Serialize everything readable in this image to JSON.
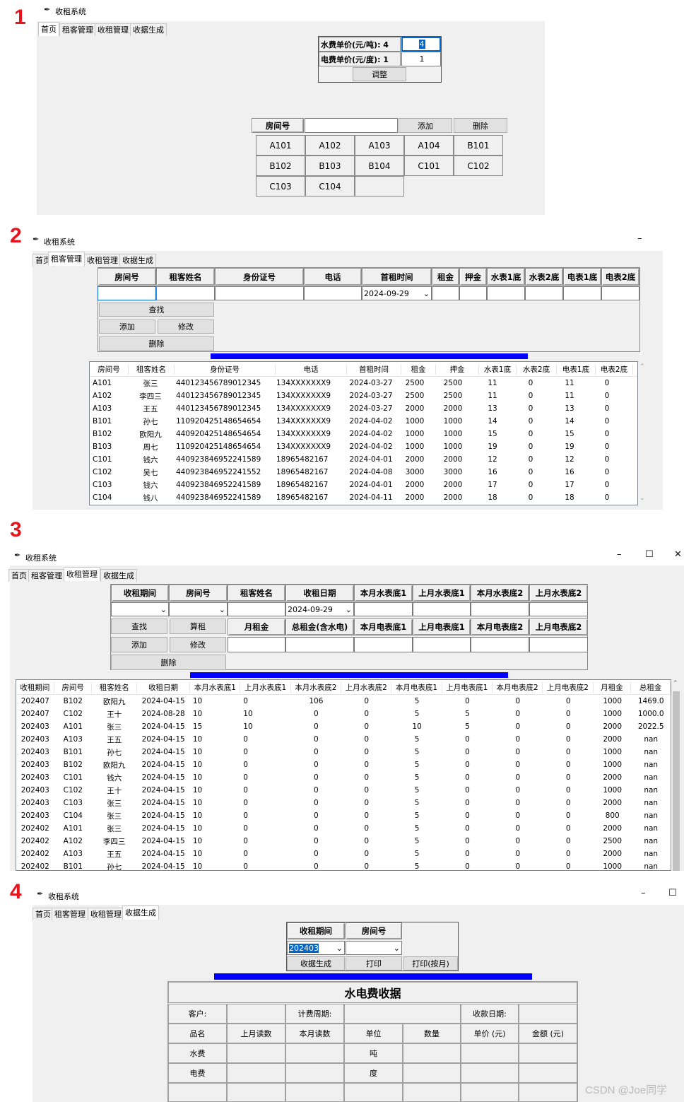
{
  "app_title": "收租系统",
  "tabs": [
    "首页",
    "租客管理",
    "收租管理",
    "收据生成"
  ],
  "section_numbers": [
    "1",
    "2",
    "3",
    "4"
  ],
  "s1": {
    "water_price_label": "水费单价(元/吨): 4",
    "water_price_value": "4",
    "elec_price_label": "电费单价(元/度): 1",
    "elec_price_value": "1",
    "adjust_btn": "调整",
    "room_label": "房间号",
    "add_btn": "添加",
    "del_btn": "删除",
    "rooms": [
      "A101",
      "A102",
      "A103",
      "A104",
      "B101",
      "B102",
      "B103",
      "B104",
      "C101",
      "C102",
      "C103",
      "C104",
      ""
    ]
  },
  "s2": {
    "headers": [
      "房间号",
      "租客姓名",
      "身份证号",
      "电话",
      "首租时间",
      "租金",
      "押金",
      "水表1底",
      "水表2底",
      "电表1底",
      "电表2底"
    ],
    "date_value": "2024-09-29",
    "find_btn": "查找",
    "add_btn": "添加",
    "edit_btn": "修改",
    "del_btn": "删除",
    "columns": [
      "房间号",
      "租客姓名",
      "身份证号",
      "电话",
      "首租时间",
      "租金",
      "押金",
      "水表1底",
      "水表2底",
      "电表1底",
      "电表2底"
    ],
    "rows": [
      [
        "A101",
        "张三",
        "440123456789012345",
        "134XXXXXXX9",
        "2024-03-27",
        "2500",
        "2500",
        "11",
        "0",
        "11",
        "0"
      ],
      [
        "A102",
        "李四三",
        "440123456789012345",
        "134XXXXXXX9",
        "2024-03-27",
        "2500",
        "2500",
        "11",
        "0",
        "11",
        "0"
      ],
      [
        "A103",
        "王五",
        "440123456789012345",
        "134XXXXXXX9",
        "2024-03-27",
        "2000",
        "2000",
        "13",
        "0",
        "13",
        "0"
      ],
      [
        "B101",
        "孙七",
        "110920425148654654",
        "134XXXXXXX9",
        "2024-04-02",
        "1000",
        "1000",
        "14",
        "0",
        "14",
        "0"
      ],
      [
        "B102",
        "欧阳九",
        "440920425148654654",
        "134XXXXXXX9",
        "2024-04-02",
        "1000",
        "1000",
        "15",
        "0",
        "15",
        "0"
      ],
      [
        "B103",
        "周七",
        "110920425148654654",
        "134XXXXXXX9",
        "2024-04-02",
        "1000",
        "1000",
        "19",
        "0",
        "19",
        "0"
      ],
      [
        "C101",
        "钱六",
        "440923846952241589",
        "18965482167",
        "2024-04-01",
        "2000",
        "2000",
        "12",
        "0",
        "12",
        "0"
      ],
      [
        "C102",
        "吴七",
        "440923846952241552",
        "18965482167",
        "2024-04-08",
        "3000",
        "3000",
        "16",
        "0",
        "16",
        "0"
      ],
      [
        "C103",
        "钱六",
        "440923846952241589",
        "18965482167",
        "2024-04-01",
        "2000",
        "2000",
        "17",
        "0",
        "17",
        "0"
      ],
      [
        "C104",
        "钱八",
        "440923846952241589",
        "18965482167",
        "2024-04-11",
        "2000",
        "2000",
        "18",
        "0",
        "18",
        "0"
      ]
    ]
  },
  "s3": {
    "headers_top": [
      "收租期间",
      "房间号",
      "租客姓名",
      "收租日期",
      "本月水表底1",
      "上月水表底1",
      "本月水表底2",
      "上月水表底2"
    ],
    "headers_mid": [
      "月租金",
      "总租金(含水电)",
      "本月电表底1",
      "上月电表底1",
      "本月电表底2",
      "上月电表底2"
    ],
    "date_value": "2024-09-29",
    "find_btn": "查找",
    "calc_btn": "算租",
    "add_btn": "添加",
    "edit_btn": "修改",
    "del_btn": "删除",
    "columns": [
      "收租期间",
      "房间号",
      "租客姓名",
      "收租日期",
      "本月水表底1",
      "上月水表底1",
      "本月水表底2",
      "上月水表底2",
      "本月电表底1",
      "上月电表底1",
      "本月电表底2",
      "上月电表底2",
      "月租金",
      "总租金"
    ],
    "rows": [
      [
        "202407",
        "B102",
        "欧阳九",
        "2024-04-15",
        "10",
        "0",
        "106",
        "0",
        "5",
        "0",
        "0",
        "0",
        "1000",
        "1469.0"
      ],
      [
        "202407",
        "C102",
        "王十",
        "2024-08-28",
        "10",
        "10",
        "0",
        "0",
        "5",
        "5",
        "0",
        "0",
        "1000",
        "1000.0"
      ],
      [
        "202403",
        "A101",
        "张三",
        "2024-04-15",
        "15",
        "10",
        "0",
        "0",
        "10",
        "5",
        "0",
        "0",
        "2000",
        "2022.5"
      ],
      [
        "202403",
        "A103",
        "王五",
        "2024-04-15",
        "10",
        "0",
        "0",
        "0",
        "5",
        "0",
        "0",
        "0",
        "2000",
        "nan"
      ],
      [
        "202403",
        "B101",
        "孙七",
        "2024-04-15",
        "10",
        "0",
        "0",
        "0",
        "5",
        "0",
        "0",
        "0",
        "1000",
        "nan"
      ],
      [
        "202403",
        "B102",
        "欧阳九",
        "2024-04-15",
        "10",
        "0",
        "0",
        "0",
        "5",
        "0",
        "0",
        "0",
        "1000",
        "nan"
      ],
      [
        "202403",
        "C101",
        "钱六",
        "2024-04-15",
        "10",
        "0",
        "0",
        "0",
        "5",
        "0",
        "0",
        "0",
        "2000",
        "nan"
      ],
      [
        "202403",
        "C102",
        "王十",
        "2024-04-15",
        "10",
        "0",
        "0",
        "0",
        "5",
        "0",
        "0",
        "0",
        "1000",
        "nan"
      ],
      [
        "202403",
        "C103",
        "张三",
        "2024-04-15",
        "10",
        "0",
        "0",
        "0",
        "5",
        "0",
        "0",
        "0",
        "2000",
        "nan"
      ],
      [
        "202403",
        "C104",
        "张三",
        "2024-04-15",
        "10",
        "0",
        "0",
        "0",
        "5",
        "0",
        "0",
        "0",
        "800",
        "nan"
      ],
      [
        "202402",
        "A101",
        "张三",
        "2024-04-15",
        "10",
        "0",
        "0",
        "0",
        "5",
        "0",
        "0",
        "0",
        "2000",
        "nan"
      ],
      [
        "202402",
        "A102",
        "李四三",
        "2024-04-15",
        "10",
        "0",
        "0",
        "0",
        "5",
        "0",
        "0",
        "0",
        "2500",
        "nan"
      ],
      [
        "202402",
        "A103",
        "王五",
        "2024-04-15",
        "10",
        "0",
        "0",
        "0",
        "5",
        "0",
        "0",
        "0",
        "2000",
        "nan"
      ],
      [
        "202402",
        "B101",
        "孙七",
        "2024-04-15",
        "10",
        "0",
        "0",
        "0",
        "5",
        "0",
        "0",
        "0",
        "1000",
        "nan"
      ]
    ]
  },
  "s4": {
    "period_label": "收租期间",
    "room_label": "房间号",
    "period_value": "202403",
    "gen_btn": "收据生成",
    "print_btn": "打印",
    "print_month_btn": "打印(按月)",
    "receipt_title": "水电费收据",
    "customer": "客户:",
    "billing_period": "计费周期:",
    "receipt_date": "收款日期:",
    "cols": [
      "品名",
      "上月读数",
      "本月读数",
      "单位",
      "数量",
      "单价 (元)",
      "金额 (元)"
    ],
    "water": "水费",
    "water_unit": "吨",
    "elec": "电费",
    "elec_unit": "度"
  },
  "watermark": "CSDN @Joe同学"
}
